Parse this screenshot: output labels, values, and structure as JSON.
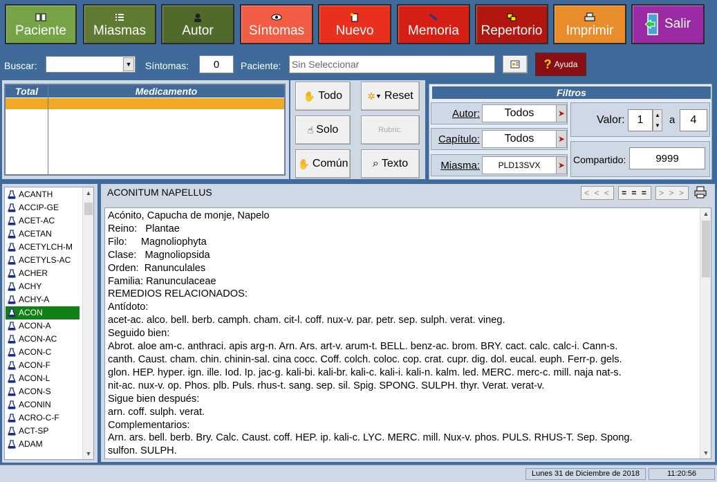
{
  "toolbar": {
    "buttons": [
      {
        "label": "Paciente",
        "color": "#77a347"
      },
      {
        "label": "Miasmas",
        "color": "#5e7a33"
      },
      {
        "label": "Autor",
        "color": "#506a2c"
      },
      {
        "label": "Síntomas",
        "color": "#f25c45"
      },
      {
        "label": "Nuevo",
        "color": "#e9301c"
      },
      {
        "label": "Memoria",
        "color": "#d51f15"
      },
      {
        "label": "Repertorio",
        "color": "#b21610"
      },
      {
        "label": "Imprimir",
        "color": "#e98d2c"
      },
      {
        "label": "Salir",
        "color": "#9a2ba4"
      }
    ]
  },
  "search": {
    "buscar_label": "Buscar:",
    "buscar_value": "",
    "sintomas_label": "Síntomas:",
    "sintomas_value": "0",
    "paciente_label": "Paciente:",
    "paciente_value": "Sin Seleccionar",
    "ayuda_label": "Ayuda"
  },
  "table": {
    "col_total": "Total",
    "col_medicamento": "Medicamento"
  },
  "actions": {
    "todo": "Todo",
    "solo": "Solo",
    "comun": "Común",
    "reset": "Reset",
    "rubric": "Rubric.",
    "texto": "Texto"
  },
  "filters": {
    "title": "Filtros",
    "autor_label": "Autor:",
    "autor_value": "Todos",
    "capitulo_label": "Capítulo:",
    "capitulo_value": "Todos",
    "miasma_label": "Miasma:",
    "miasma_value": "PLD13SVX",
    "valor_label": "Valor:",
    "valor_from": "1",
    "valor_sep": "a",
    "valor_to": "4",
    "compartido_label": "Compartido:",
    "compartido_value": "9999"
  },
  "remedies": {
    "items": [
      "ACANTH",
      "ACCIP-GE",
      "ACET-AC",
      "ACETAN",
      "ACETYLCH-M",
      "ACETYLS-AC",
      "ACHER",
      "ACHY",
      "ACHY-A",
      "ACON",
      "ACON-A",
      "ACON-AC",
      "ACON-C",
      "ACON-F",
      "ACON-L",
      "ACON-S",
      "ACONIN",
      "ACRO-C-F",
      "ACT-SP",
      "ADAM"
    ],
    "selected": "ACON"
  },
  "content": {
    "title": "ACONITUM NAPELLUS",
    "nav_prev": "< < <",
    "nav_eq": "= = =",
    "nav_next": "> > >",
    "lines": [
      "Acónito, Capucha de monje, Napelo",
      "Reino:   Plantae",
      "Filo:     Magnoliophyta",
      "Clase:   Magnoliopsida",
      "Orden:  Ranunculales",
      "Familia: Ranunculaceae",
      "REMEDIOS RELACIONADOS:",
      "Antídoto:",
      "acet-ac. alco. bell. berb. camph. cham. cit-l. coff. nux-v. par. petr. sep. sulph. verat. vineg.",
      "Seguido bien:",
      "Abrot. aloe am-c. anthraci. apis arg-n. Arn. Ars. art-v. arum-t. BELL. benz-ac. brom. BRY. cact. calc. calc-i. Cann-s.",
      "canth. Caust. cham. chin. chinin-sal. cina cocc. Coff. colch. coloc. cop. crat. cupr. dig. dol. eucal. euph. Ferr-p. gels.",
      "glon. HEP. hyper. ign. ille. Iod. Ip. jac-g. kali-bi. kali-br. kali-c. kali-i. kali-n. kalm. led. MERC. merc-c. mill. naja nat-s.",
      "nit-ac. nux-v. op. Phos. plb. Puls. rhus-t. sang. sep. sil. Spig. SPONG. SULPH. thyr. Verat. verat-v.",
      "Sigue bien después:",
      "arn. coff. sulph. verat.",
      "Complementarios:",
      "Arn. ars. bell. berb. Bry. Calc. Caust. coff. HEP. ip. kali-c. LYC. MERC. mill. Nux-v. phos. PULS. RHUS-T. Sep. Spong.",
      "sulfon. SULPH."
    ]
  },
  "status": {
    "date": "Lunes 31 de Diciembre de 2018",
    "time": "11:20:56"
  }
}
